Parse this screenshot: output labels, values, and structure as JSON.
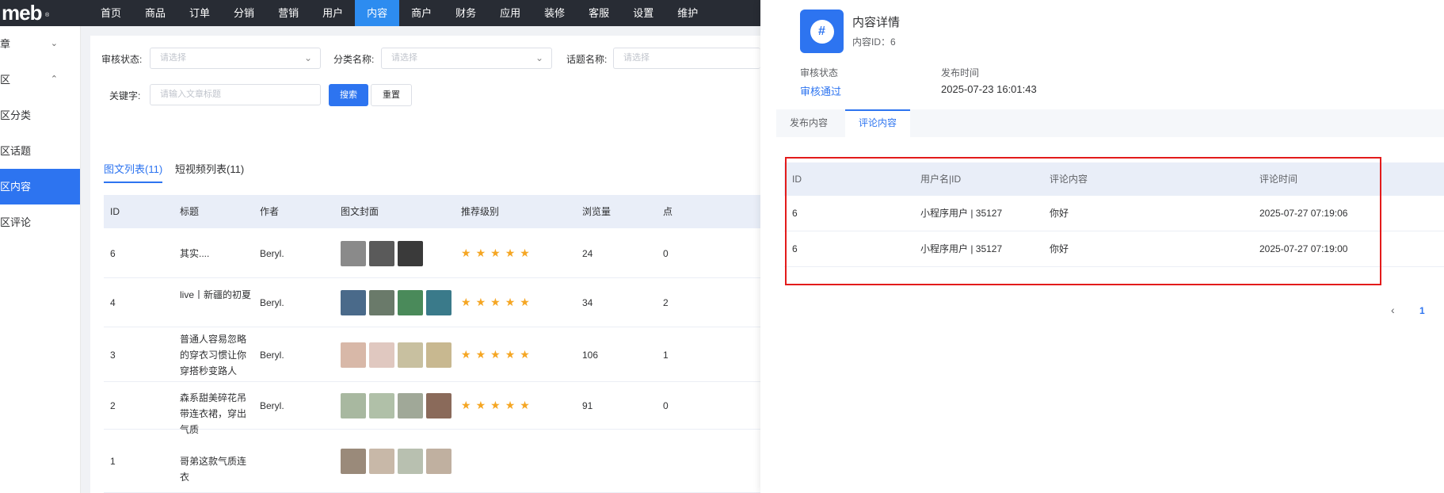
{
  "logo": {
    "text": "meb",
    "mark": "®"
  },
  "nav": [
    "首页",
    "商品",
    "订单",
    "分销",
    "营销",
    "用户",
    "内容",
    "商户",
    "财务",
    "应用",
    "装修",
    "客服",
    "设置",
    "维护"
  ],
  "nav_active": "内容",
  "sidebar": {
    "items": [
      {
        "label": "章",
        "chevron": "⌄"
      },
      {
        "label": "区",
        "chevron": "⌃"
      },
      {
        "label": "区分类"
      },
      {
        "label": "区话题"
      },
      {
        "label": "区内容"
      },
      {
        "label": "区评论"
      }
    ]
  },
  "filters": {
    "status_label": "审核状态:",
    "status_placeholder": "请选择",
    "category_label": "分类名称:",
    "category_placeholder": "请选择",
    "topic_label": "话题名称:",
    "topic_placeholder": "请选择",
    "keyword_label": "关键字:",
    "keyword_placeholder": "请输入文章标题",
    "search_button": "搜索",
    "reset_button": "重置"
  },
  "list": {
    "tabs": [
      "图文列表(11)",
      "短视频列表(11)"
    ],
    "headers": [
      "ID",
      "标题",
      "作者",
      "图文封面",
      "推荐级别",
      "浏览量",
      "点"
    ],
    "rows": [
      {
        "id": "6",
        "title": "其实....",
        "author": "Beryl.",
        "views": "24",
        "extra": "0",
        "thumbs": [
          "#8a8a8a",
          "#5a5a5a",
          "#3a3a3a"
        ]
      },
      {
        "id": "4",
        "title": "live丨新疆的初夏",
        "author": "Beryl.",
        "views": "34",
        "extra": "2",
        "thumbs": [
          "#4a6a8a",
          "#6a7a6a",
          "#4a8a5a",
          "#3a7a8a"
        ]
      },
      {
        "id": "3",
        "title": "普通人容易忽略的穿衣习惯让你穿搭秒变路人",
        "author": "Beryl.",
        "views": "106",
        "extra": "1",
        "thumbs": [
          "#d8b8a8",
          "#e0c8c0",
          "#c8c0a0",
          "#c8b890"
        ]
      },
      {
        "id": "2",
        "title": "森系甜美碎花吊带连衣裙，穿出气质",
        "author": "Beryl.",
        "views": "91",
        "extra": "0",
        "thumbs": [
          "#a8b8a0",
          "#b0c0a8",
          "#a0a898",
          "#8a6a5a"
        ]
      },
      {
        "id": "1",
        "title": "哥弟这款气质连衣",
        "author": "",
        "views": "",
        "extra": "",
        "thumbs": [
          "#9a8a7a",
          "#c8b8a8",
          "#b8c0b0",
          "#c0b0a0"
        ]
      }
    ],
    "star_glyph": "★",
    "star_count": 5
  },
  "drawer": {
    "icon_glyph": "#",
    "title": "内容详情",
    "subtitle": "内容ID：6",
    "status_label": "审核状态",
    "status_value": "审核通过",
    "time_label": "发布时间",
    "time_value": "2025-07-23 16:01:43",
    "tabs": [
      "发布内容",
      "评论内容"
    ],
    "active_tab": "评论内容",
    "comment_headers": [
      "ID",
      "用户名|ID",
      "评论内容",
      "评论时间"
    ],
    "comments": [
      {
        "id": "6",
        "user": "小程序用户 | 35127",
        "content": "你好",
        "time": "2025-07-27 07:19:06"
      },
      {
        "id": "6",
        "user": "小程序用户 | 35127",
        "content": "你好",
        "time": "2025-07-27 07:19:00"
      }
    ],
    "pager_prev": "‹",
    "pager_current": "1"
  },
  "colors": {
    "accent": "#2d74f0",
    "highlight_box": "#e31b1b",
    "star": "#f5a623",
    "topbar": "#282c34"
  }
}
